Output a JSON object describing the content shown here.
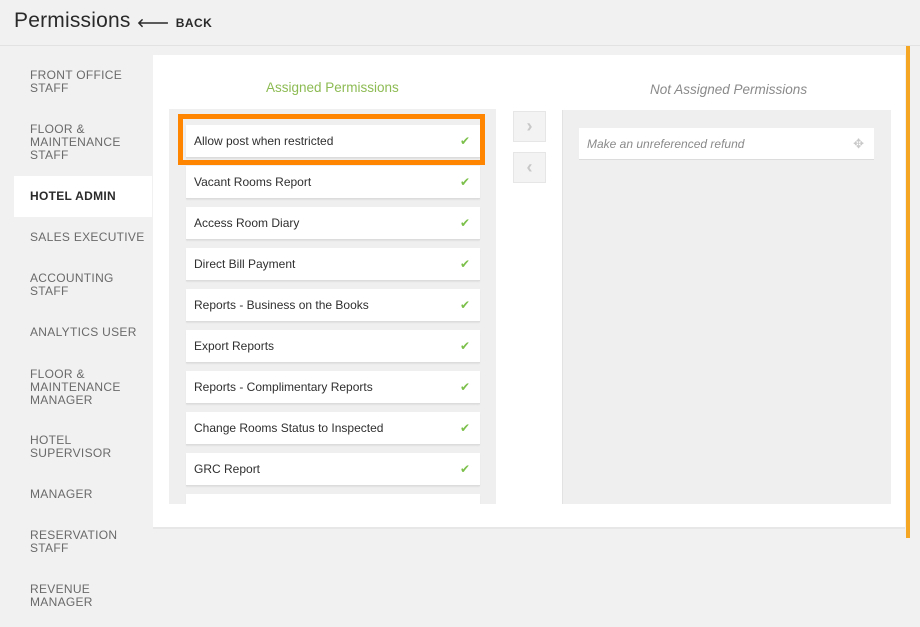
{
  "header": {
    "title": "Permissions",
    "back_arrow": "🡐",
    "back_label": "BACK"
  },
  "sidebar": {
    "items": [
      {
        "label": "FRONT OFFICE\nSTAFF",
        "active": false
      },
      {
        "label": "FLOOR &\nMAINTENANCE\nSTAFF",
        "active": false
      },
      {
        "label": "HOTEL ADMIN",
        "active": true
      },
      {
        "label": "SALES EXECUTIVE",
        "active": false
      },
      {
        "label": "ACCOUNTING\nSTAFF",
        "active": false
      },
      {
        "label": "ANALYTICS USER",
        "active": false
      },
      {
        "label": "FLOOR &\nMAINTENANCE\nMANAGER",
        "active": false
      },
      {
        "label": "HOTEL\nSUPERVISOR",
        "active": false
      },
      {
        "label": "MANAGER",
        "active": false
      },
      {
        "label": "RESERVATION\nSTAFF",
        "active": false
      },
      {
        "label": "REVENUE\nMANAGER",
        "active": false
      }
    ]
  },
  "assigned": {
    "title": "Assigned Permissions",
    "check_glyph": "✔",
    "items": [
      "Allow post when restricted",
      "Vacant Rooms Report",
      "Access Room Diary",
      "Direct Bill Payment",
      "Reports - Business on the Books",
      "Export Reports",
      "Reports - Complimentary Reports",
      "Change Rooms Status to Inspected",
      "GRC Report"
    ]
  },
  "transfer": {
    "assign_glyph": "›",
    "unassign_glyph": "‹"
  },
  "unassigned": {
    "title": "Not Assigned Permissions",
    "move_glyph": "✥",
    "items": [
      "Make an unreferenced refund"
    ]
  },
  "colors": {
    "accent_orange": "#ff8400",
    "assigned_title_green": "#8dbb53",
    "check_green": "#7cc04b",
    "scroll_accent": "#f5a623"
  }
}
